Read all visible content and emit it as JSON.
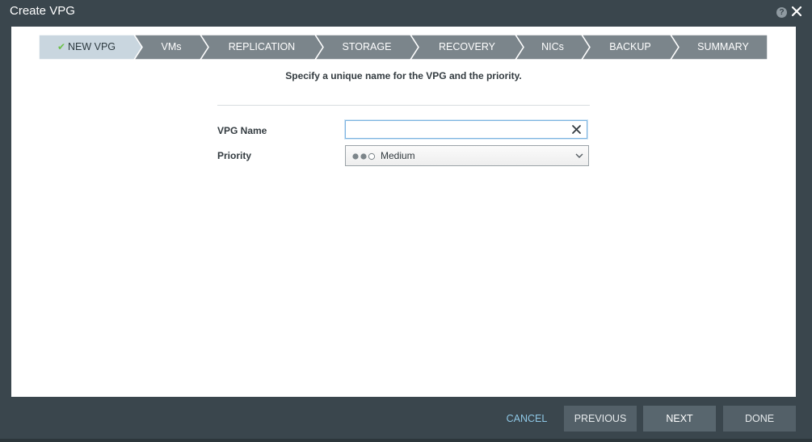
{
  "window": {
    "title": "Create VPG",
    "help_symbol": "?"
  },
  "wizard": {
    "steps": [
      {
        "label": "NEW VPG",
        "state": "active"
      },
      {
        "label": "VMs",
        "state": "pending"
      },
      {
        "label": "REPLICATION",
        "state": "pending"
      },
      {
        "label": "STORAGE",
        "state": "pending"
      },
      {
        "label": "RECOVERY",
        "state": "pending"
      },
      {
        "label": "NICs",
        "state": "pending"
      },
      {
        "label": "BACKUP",
        "state": "pending"
      },
      {
        "label": "SUMMARY",
        "state": "pending"
      }
    ],
    "subtitle": "Specify a unique name for the VPG and the priority."
  },
  "form": {
    "vpg_name_label": "VPG Name",
    "vpg_name_value": "",
    "priority_label": "Priority",
    "priority_value": "Medium",
    "priority_level": 2,
    "priority_max": 3
  },
  "footer": {
    "cancel": "CANCEL",
    "previous": "PREVIOUS",
    "next": "NEXT",
    "done": "DONE"
  },
  "colors": {
    "chrome": "#3a464d",
    "step_active": "#c9d6df",
    "step_pending": "#7b858b",
    "check": "#6cc04a",
    "link": "#8ec7e5"
  }
}
